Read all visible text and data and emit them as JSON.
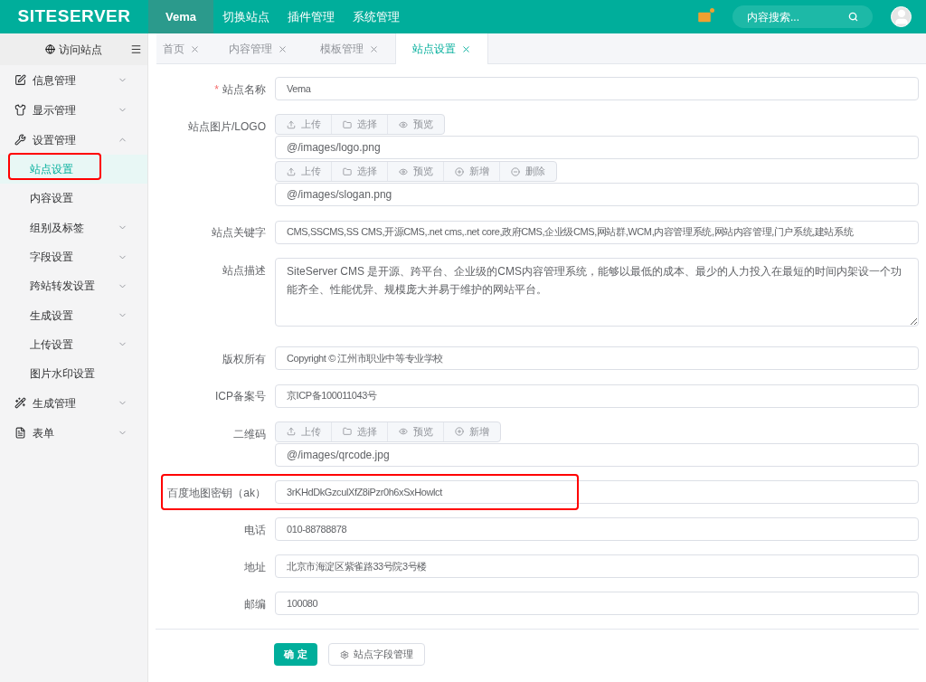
{
  "header": {
    "logo": "SITESERVER",
    "nav": [
      {
        "label": "Vema",
        "selected": true
      },
      {
        "label": "切换站点",
        "selected": false
      },
      {
        "label": "插件管理",
        "selected": false
      },
      {
        "label": "系统管理",
        "selected": false
      }
    ],
    "search": {
      "placeholder": "内容搜索..."
    }
  },
  "sidebar": {
    "visit": "访问站点",
    "items": [
      {
        "label": "信息管理",
        "expanded": false
      },
      {
        "label": "显示管理",
        "expanded": false
      },
      {
        "label": "设置管理",
        "expanded": true,
        "children": [
          {
            "label": "站点设置",
            "selected": true,
            "highlighted": true,
            "expandable": false
          },
          {
            "label": "内容设置",
            "selected": false,
            "highlighted": false,
            "expandable": false
          },
          {
            "label": "组别及标签",
            "selected": false,
            "highlighted": false,
            "expandable": true
          },
          {
            "label": "字段设置",
            "selected": false,
            "highlighted": false,
            "expandable": true
          },
          {
            "label": "跨站转发设置",
            "selected": false,
            "highlighted": false,
            "expandable": true
          },
          {
            "label": "生成设置",
            "selected": false,
            "highlighted": false,
            "expandable": true
          },
          {
            "label": "上传设置",
            "selected": false,
            "highlighted": false,
            "expandable": true
          },
          {
            "label": "图片水印设置",
            "selected": false,
            "highlighted": false,
            "expandable": false
          }
        ]
      },
      {
        "label": "生成管理",
        "expanded": false
      },
      {
        "label": "表单",
        "expanded": false
      }
    ]
  },
  "tabs": [
    {
      "label": "首页",
      "selected": false
    },
    {
      "label": "内容管理",
      "selected": false
    },
    {
      "label": "模板管理",
      "selected": false
    },
    {
      "label": "站点设置",
      "selected": true
    }
  ],
  "form": {
    "fields": [
      {
        "kind": "text",
        "label": "站点名称",
        "required_mark": "*",
        "highlighted": false,
        "value": "Vema"
      },
      {
        "kind": "upload",
        "label": "站点图片/LOGO",
        "highlighted": false,
        "groups": [
          {
            "buttons": [
              {
                "kind": "upload",
                "label": "上传"
              },
              {
                "kind": "folder",
                "label": "选择"
              },
              {
                "kind": "eye",
                "label": "预览"
              }
            ],
            "value": "@/images/logo.png"
          },
          {
            "buttons": [
              {
                "kind": "upload",
                "label": "上传"
              },
              {
                "kind": "folder",
                "label": "选择"
              },
              {
                "kind": "eye",
                "label": "预览"
              },
              {
                "kind": "plus",
                "label": "新增"
              },
              {
                "kind": "minus",
                "label": "删除"
              }
            ],
            "value": "@/images/slogan.png"
          }
        ]
      },
      {
        "kind": "text",
        "label": "站点关键字",
        "highlighted": false,
        "value": "CMS,SSCMS,SS CMS,开源CMS,.net cms,.net core,政府CMS,企业级CMS,网站群,WCM,内容管理系统,网站内容管理,门户系统,建站系统"
      },
      {
        "kind": "textarea",
        "label": "站点描述",
        "highlighted": false,
        "value": "SiteServer CMS 是开源、跨平台、企业级的CMS内容管理系统，能够以最低的成本、最少的人力投入在最短的时间内架设一个功能齐全、性能优异、规模庞大并易于维护的网站平台。"
      },
      {
        "kind": "text",
        "label": "版权所有",
        "highlighted": false,
        "value": "Copyright © 江州市职业中等专业学校"
      },
      {
        "kind": "text",
        "label": "ICP备案号",
        "highlighted": false,
        "value": "京ICP备100011043号"
      },
      {
        "kind": "upload",
        "label": "二维码",
        "highlighted": false,
        "groups": [
          {
            "buttons": [
              {
                "kind": "upload",
                "label": "上传"
              },
              {
                "kind": "folder",
                "label": "选择"
              },
              {
                "kind": "eye",
                "label": "预览"
              },
              {
                "kind": "plus",
                "label": "新增"
              }
            ],
            "value": "@/images/qrcode.jpg"
          }
        ]
      },
      {
        "kind": "text",
        "label": "百度地图密钥（ak）",
        "highlighted": true,
        "value": "3rKHdDkGzculXfZ8iPzr0h6xSxHowlct"
      },
      {
        "kind": "text",
        "label": "电话",
        "highlighted": false,
        "value": "010-88788878"
      },
      {
        "kind": "text",
        "label": "地址",
        "highlighted": false,
        "value": "北京市海淀区紫雀路33号院3号楼"
      },
      {
        "kind": "text",
        "label": "邮编",
        "highlighted": false,
        "value": "100080"
      }
    ],
    "submit": "确 定",
    "fields_button": "站点字段管理"
  }
}
